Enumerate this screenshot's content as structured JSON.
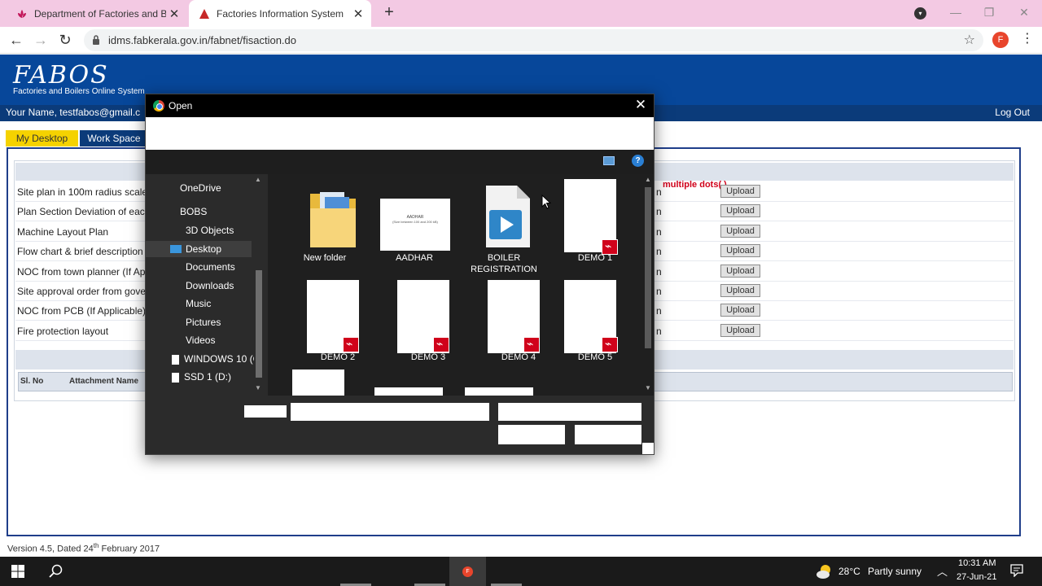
{
  "browser": {
    "tabs": [
      {
        "title": "Department of Factories and Boil",
        "favicon": "lotus-icon"
      },
      {
        "title": "Factories Information System",
        "favicon": "triangle-icon"
      }
    ],
    "url": "idms.fabkerala.gov.in/fabnet/fisaction.do",
    "profile_letter": "F"
  },
  "site": {
    "logo": "FABOS",
    "logo_sub": "Factories and Boilers Online System",
    "user": "Your Name, testfabos@gmail.c",
    "logout": "Log Out",
    "tabs": [
      "My Desktop",
      "Work Space"
    ],
    "warning": "multiple dots(.)",
    "documents": [
      {
        "label": "Site plan in 100m radius scale",
        "status": "n",
        "action": "Upload"
      },
      {
        "label": "Plan Section Deviation of each",
        "status": "n",
        "action": "Upload"
      },
      {
        "label": "Machine Layout Plan",
        "status": "n",
        "action": "Upload"
      },
      {
        "label": "Flow chart & brief description",
        "status": "n",
        "action": "Upload"
      },
      {
        "label": "NOC from town planner (If Ap",
        "status": "n",
        "action": "Upload"
      },
      {
        "label": "Site approval order from gove",
        "status": "n",
        "action": "Upload"
      },
      {
        "label": "NOC from PCB (If Applicable)",
        "status": "n",
        "action": "Upload"
      },
      {
        "label": "Fire protection layout",
        "status": "n",
        "action": "Upload"
      }
    ],
    "attachments_header": {
      "sl_no": "Sl. No",
      "name": "Attachment Name"
    },
    "version_prefix": "Version 4.5, Dated 24",
    "version_sup": "th",
    "version_suffix": " February 2017"
  },
  "dialog": {
    "title": "Open",
    "nav": [
      {
        "label": "OneDrive",
        "icon": "cloud-icon"
      },
      {
        "label": "BOBS",
        "icon": "user-folder-icon"
      },
      {
        "label": "3D Objects",
        "icon": "cube-icon"
      },
      {
        "label": "Desktop",
        "icon": "desktop-icon",
        "selected": true
      },
      {
        "label": "Documents",
        "icon": "documents-icon"
      },
      {
        "label": "Downloads",
        "icon": "download-icon"
      },
      {
        "label": "Music",
        "icon": "music-icon"
      },
      {
        "label": "Pictures",
        "icon": "pictures-icon"
      },
      {
        "label": "Videos",
        "icon": "videos-icon"
      },
      {
        "label": "WINDOWS 10 (C",
        "icon": "drive-icon"
      },
      {
        "label": "SSD 1 (D:)",
        "icon": "drive-icon"
      }
    ],
    "files": [
      {
        "name": "New folder",
        "kind": "folder"
      },
      {
        "name": "AADHAR",
        "kind": "image",
        "preview_title": "AADHAR",
        "preview_sub": "(Size between 100 and 200 kB)"
      },
      {
        "name": "BOILER REGISTRATION",
        "kind": "video"
      },
      {
        "name": "DEMO 1",
        "kind": "pdf"
      },
      {
        "name": "DEMO 2",
        "kind": "pdf"
      },
      {
        "name": "DEMO 3",
        "kind": "pdf"
      },
      {
        "name": "DEMO 4",
        "kind": "pdf"
      },
      {
        "name": "DEMO 5",
        "kind": "pdf"
      }
    ]
  },
  "taskbar": {
    "weather_temp": "28°C",
    "weather_text": "Partly sunny",
    "time": "10:31 AM",
    "date": "27-Jun-21"
  }
}
